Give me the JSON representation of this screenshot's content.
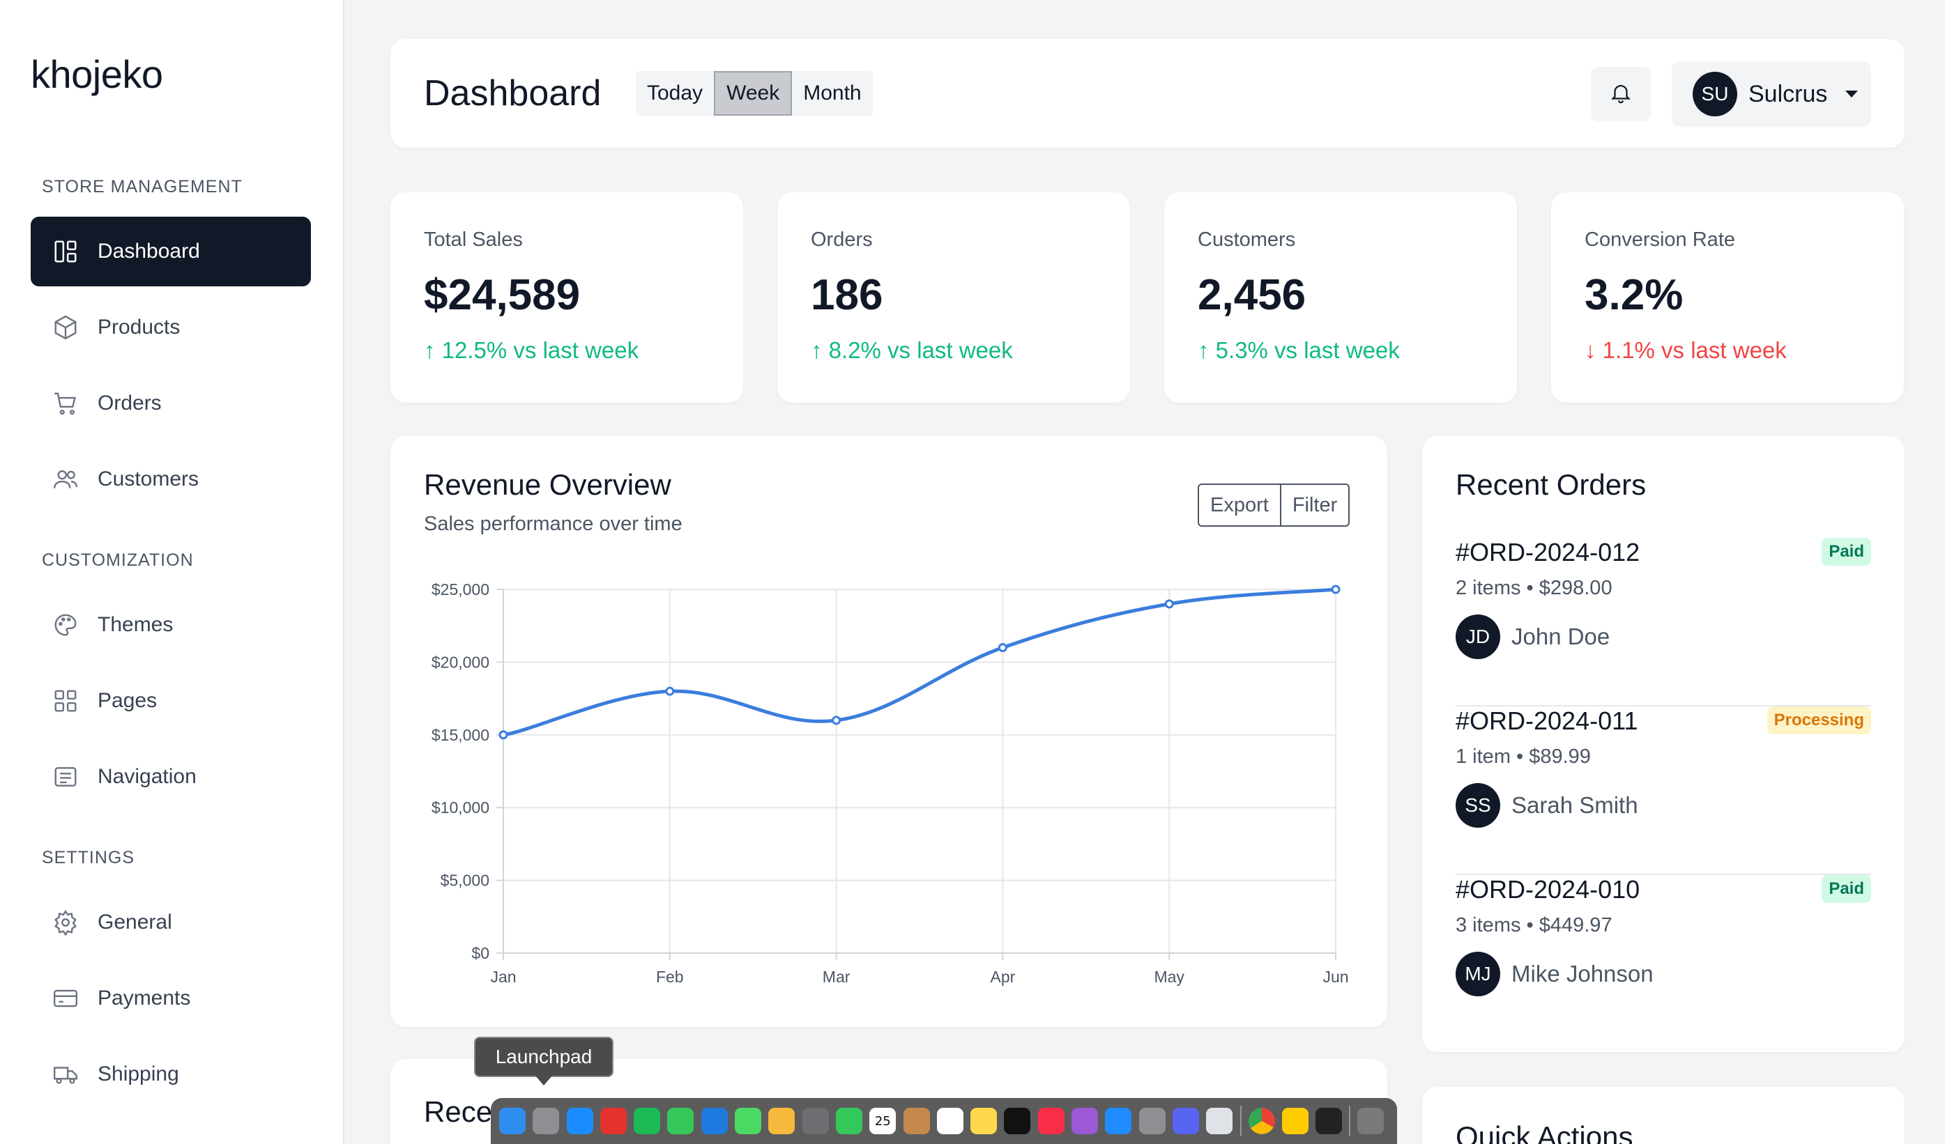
{
  "app": {
    "logo": "khojeko"
  },
  "sidebar": {
    "sections": [
      {
        "label": "STORE MANAGEMENT"
      },
      {
        "label": "CUSTOMIZATION"
      },
      {
        "label": "SETTINGS"
      }
    ],
    "items": [
      {
        "label": "Dashboard",
        "icon": "layout-icon",
        "active": true
      },
      {
        "label": "Products",
        "icon": "box-icon"
      },
      {
        "label": "Orders",
        "icon": "cart-icon"
      },
      {
        "label": "Customers",
        "icon": "users-icon"
      },
      {
        "label": "Themes",
        "icon": "palette-icon"
      },
      {
        "label": "Pages",
        "icon": "grid-icon"
      },
      {
        "label": "Navigation",
        "icon": "list-icon"
      },
      {
        "label": "General",
        "icon": "gear-icon"
      },
      {
        "label": "Payments",
        "icon": "credit-card-icon"
      },
      {
        "label": "Shipping",
        "icon": "truck-icon"
      }
    ]
  },
  "header": {
    "title": "Dashboard",
    "ranges": [
      "Today",
      "Week",
      "Month"
    ],
    "selected_range": "Week",
    "user": {
      "initials": "SU",
      "name": "Sulcrus"
    }
  },
  "stats": [
    {
      "label": "Total Sales",
      "value": "$24,589",
      "delta": "↑ 12.5% vs last week",
      "trend": "up"
    },
    {
      "label": "Orders",
      "value": "186",
      "delta": "↑ 8.2% vs last week",
      "trend": "up"
    },
    {
      "label": "Customers",
      "value": "2,456",
      "delta": "↑ 5.3% vs last week",
      "trend": "up"
    },
    {
      "label": "Conversion Rate",
      "value": "3.2%",
      "delta": "↓ 1.1% vs last week",
      "trend": "down"
    }
  ],
  "revenue": {
    "title": "Revenue Overview",
    "subtitle": "Sales performance over time",
    "export_label": "Export",
    "filter_label": "Filter"
  },
  "chart_data": {
    "type": "line",
    "categories": [
      "Jan",
      "Feb",
      "Mar",
      "Apr",
      "May",
      "Jun"
    ],
    "values": [
      15000,
      18000,
      16000,
      21000,
      24000,
      25000
    ],
    "ylim": [
      0,
      25000
    ],
    "yticks": [
      "$0",
      "$5,000",
      "$10,000",
      "$15,000",
      "$20,000",
      "$25,000"
    ],
    "grid": true,
    "color": "#3b7ddd"
  },
  "recent_orders": {
    "title": "Recent Orders",
    "orders": [
      {
        "id": "#ORD-2024-012",
        "meta": "2 items • $298.00",
        "status": "Paid",
        "status_type": "paid",
        "initials": "JD",
        "name": "John Doe"
      },
      {
        "id": "#ORD-2024-011",
        "meta": "1 item • $89.99",
        "status": "Processing",
        "status_type": "processing",
        "initials": "SS",
        "name": "Sarah Smith"
      },
      {
        "id": "#ORD-2024-010",
        "meta": "3 items • $449.97",
        "status": "Paid",
        "status_type": "paid",
        "initials": "MJ",
        "name": "Mike Johnson"
      }
    ]
  },
  "bottom": {
    "left_title": "Rece",
    "right_title": "Quick Actions"
  },
  "dock": {
    "tooltip": "Launchpad",
    "calendar_day": "25",
    "apps": [
      "finder-icon",
      "launchpad-icon",
      "safari-icon",
      "opera-icon",
      "spotify-icon",
      "messages-icon",
      "mail-icon",
      "maps-icon",
      "photos-icon",
      "screenshot-icon",
      "facetime-icon",
      "calendar-icon",
      "notes-app-icon",
      "reminders-icon",
      "notes-icon",
      "tv-icon",
      "music-icon",
      "podcasts-icon",
      "appstore-icon",
      "settings-icon",
      "discord-icon",
      "roblox-icon",
      "chrome-icon",
      "tableplus-icon",
      "editor-icon",
      "trash-icon"
    ]
  }
}
